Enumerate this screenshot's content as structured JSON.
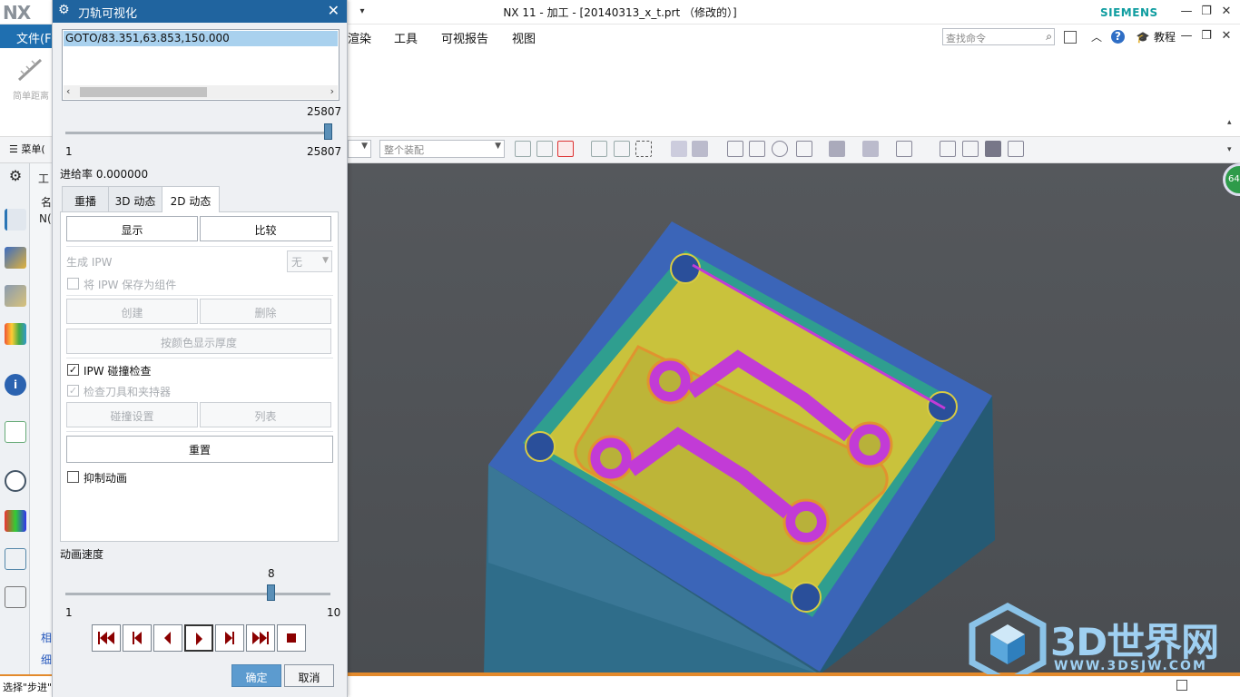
{
  "app": {
    "logo": "NX",
    "window_title": "NX 11 - 加工 - [20140313_x_t.prt （修改的）]",
    "brand": "SIEMENS"
  },
  "menubar": {
    "file": "文件(F",
    "items": [
      "渲染",
      "工具",
      "可视报告",
      "视图"
    ],
    "search_placeholder": "查找命令",
    "tutorial": "教程"
  },
  "ribbon": {
    "tool_label": "简单距离"
  },
  "toolbar": {
    "menu_label": "菜单(",
    "assembly_combo": "整个装配"
  },
  "navigator": {
    "header_fragment": "工",
    "col_fragment": "名",
    "row_fragment": "N(",
    "bottom_labels": [
      "相",
      "细"
    ]
  },
  "dialog": {
    "title": "刀轨可视化",
    "list_item": "GOTO/83.351,63.853,150.000",
    "position_slider": {
      "min": "1",
      "max": "25807",
      "value": "25807"
    },
    "feed_rate": "进给率 0.000000",
    "tabs": [
      "重播",
      "3D 动态",
      "2D 动态"
    ],
    "active_tab": "2D 动态",
    "buttons": {
      "display": "显示",
      "compare": "比较",
      "create": "创建",
      "delete": "删除",
      "color_thickness": "按颜色显示厚度",
      "collision_settings": "碰撞设置",
      "list": "列表",
      "reset": "重置"
    },
    "generate_ipw": "生成 IPW",
    "generate_ipw_value": "无",
    "save_ipw": "将 IPW 保存为组件",
    "ipw_collision": "IPW 碰撞检查",
    "check_tool_holder": "检查刀具和夹持器",
    "suppress_animation": "抑制动画",
    "speed_label": "动画速度",
    "speed_slider": {
      "min": "1",
      "max": "10",
      "value": "8"
    },
    "ok": "确定",
    "cancel": "取消"
  },
  "viewport": {
    "badge": "64",
    "watermark_title": "3D世界网",
    "watermark_url": "WWW.3DSJW.COM"
  },
  "status": {
    "text": "选择\"步进\""
  },
  "colors": {
    "accent_blue": "#20649f",
    "viewport_bg": "#505358",
    "part_blue": "#3b65b8",
    "floor_yellow": "#c9c23c",
    "toolpath_magenta": "#c23bd6"
  }
}
